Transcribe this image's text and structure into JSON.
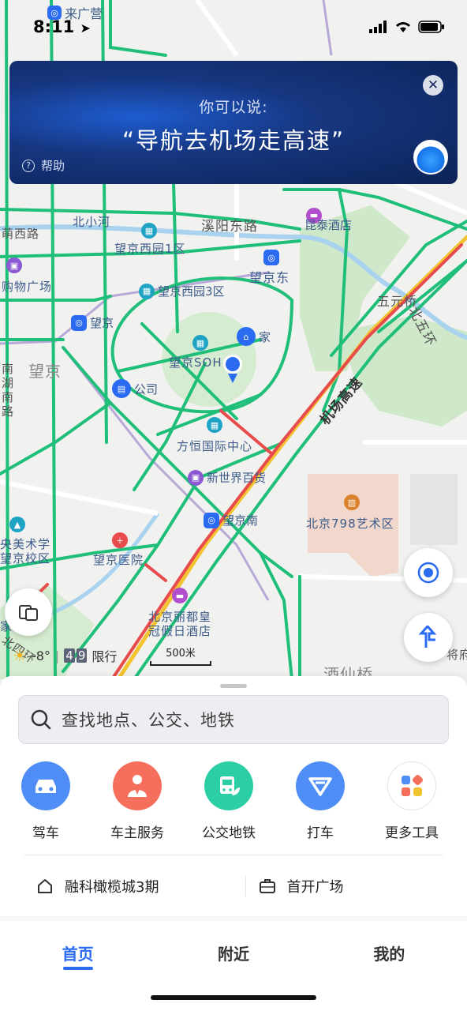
{
  "status_bar": {
    "time": "8:11",
    "top_label": "来广营"
  },
  "voice_card": {
    "hint": "你可以说:",
    "quote": "“导航去机场走高速”",
    "help": "帮助",
    "close_icon": "close-icon",
    "mascot_icon": "voice-assistant-mascot-icon"
  },
  "map": {
    "labels": {
      "yinghe": "萌西路",
      "beixiaohe": "北小河",
      "xiyang_east": "溪阳东路",
      "kuntai": "昆泰酒店",
      "wangjing_xiyuan1": "望京西园1区",
      "shopping": "购物广场",
      "wangjing_east": "望京东",
      "wangjing_xiyuan3": "望京西园3区",
      "wuyuanqiao": "五元桥",
      "wangjing_station": "望京",
      "home": "家",
      "wangjing_soho": "望京SOH",
      "north_5th_ring": "北五环",
      "wangjing_district": "望京",
      "nanhu": "南湖南路",
      "company": "公司",
      "airport_expressway": "机场高速",
      "fangheng": "方恒国际中心",
      "new_world": "新世界百货",
      "wangjing_south": "望京南",
      "art_798": "北京798艺术区",
      "cafa": "央美术学",
      "wangjing_campus": "望京校区",
      "wangjing_hospital": "望京医院",
      "holiday_inn_1": "北京丽都皇",
      "holiday_inn_2": "冠假日酒店",
      "jiuxianqiao": "酒仙桥",
      "north_4th_ring": "北四环",
      "jiayuan": "家",
      "jiangfu": "将府"
    },
    "weather": {
      "temp": "-8°",
      "plate_a": "4",
      "plate_b": "9",
      "restrict": "限行"
    },
    "scale": "500米"
  },
  "search": {
    "placeholder": "查找地点、公交、地铁"
  },
  "quick_actions": [
    {
      "label": "驾车",
      "icon": "car-icon",
      "color": "#4f8ef7"
    },
    {
      "label": "车主服务",
      "icon": "driver-service-icon",
      "color": "#f56f5c"
    },
    {
      "label": "公交地铁",
      "icon": "bus-icon",
      "color": "#2ccfa5"
    },
    {
      "label": "打车",
      "icon": "taxi-icon",
      "color": "#4f8ef7"
    },
    {
      "label": "更多工具",
      "icon": "more-tools-icon",
      "color": "#ffffff"
    }
  ],
  "places": [
    {
      "label": "融科橄榄城3期",
      "icon": "home-icon"
    },
    {
      "label": "首开广场",
      "icon": "briefcase-icon"
    }
  ],
  "tabs": [
    {
      "label": "首页",
      "active": true
    },
    {
      "label": "附近",
      "active": false
    },
    {
      "label": "我的",
      "active": false
    }
  ]
}
